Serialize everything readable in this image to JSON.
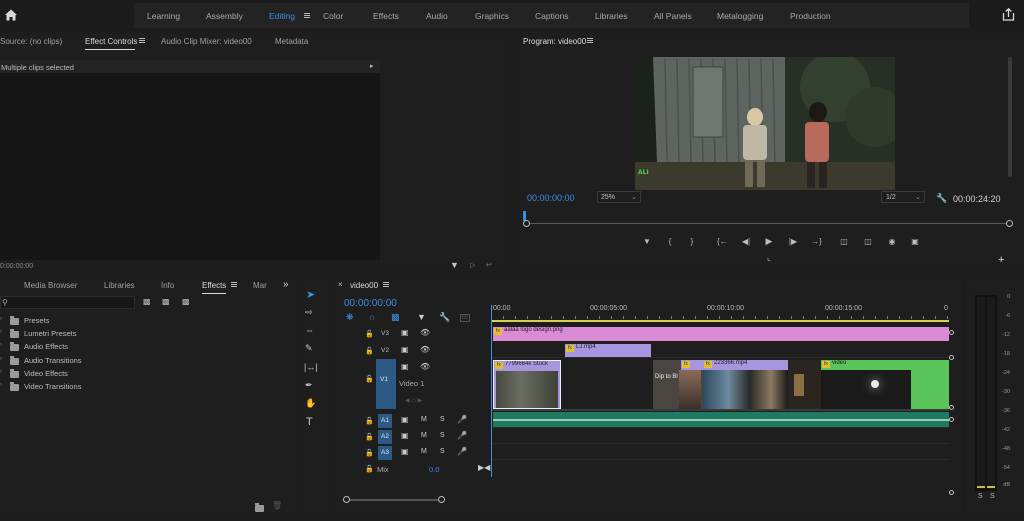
{
  "workspaces": {
    "home_icon": "home-icon",
    "items": [
      "Learning",
      "Assembly",
      "Editing",
      "Color",
      "Effects",
      "Audio",
      "Graphics",
      "Captions",
      "Libraries",
      "All Panels",
      "Metalogging",
      "Production"
    ],
    "active": "Editing",
    "accent_color": "#3d8ee8"
  },
  "source_panel": {
    "tabs": [
      "Source: (no clips)",
      "Effect Controls",
      "Audio Clip Mixer: video00",
      "Metadata"
    ],
    "active_tab": "Effect Controls",
    "message": "Multiple clips selected",
    "timecode": "0:00:00:00"
  },
  "program_monitor": {
    "title": "Program: video00",
    "timecode": "00:00:00:00",
    "zoom": "25%",
    "resolution": "1/2",
    "duration": "00:00:24:20"
  },
  "effects_panel": {
    "tabs": [
      "Media Browser",
      "Libraries",
      "Info",
      "Effects",
      "Mar"
    ],
    "active_tab": "Effects",
    "search_placeholder": "",
    "folders": [
      "Presets",
      "Lumetri Presets",
      "Audio Effects",
      "Audio Transitions",
      "Video Effects",
      "Video Transitions"
    ]
  },
  "timeline": {
    "sequence": "video00",
    "timecode": "00:00:00:00",
    "ruler": [
      ":00:00",
      "00:00:05:00",
      "00:00:10:00",
      "00:00:15:00",
      "0"
    ],
    "tracks": {
      "v3": "V3",
      "v2": "V2",
      "v1": "V1",
      "v1_name": "Video 1",
      "a1": "A1",
      "a2": "A2",
      "a3": "A3",
      "mix_label": "Mix",
      "mix_value": "0.0"
    },
    "clips": {
      "logo": "aalaa logo design.png",
      "lj": "LJ.mp4",
      "stock": "7799664k Stock",
      "dip": "Dip to Bl",
      "c223": "223366.mp4",
      "video": "video"
    },
    "track_buttons": {
      "mute": "M",
      "solo": "S"
    }
  },
  "audio_meter": {
    "scale": [
      "0",
      "-6",
      "-12",
      "-18",
      "-24",
      "-30",
      "-36",
      "-42",
      "-48",
      "-54",
      "dB"
    ],
    "solo_left": "S",
    "solo_right": "S"
  },
  "colors": {
    "logo_clip": "#d98bd6",
    "video_clip": "#a795df",
    "green_clip": "#58c45a",
    "audio_clip": "#1f7a61",
    "playhead": "#3d8ee8"
  }
}
